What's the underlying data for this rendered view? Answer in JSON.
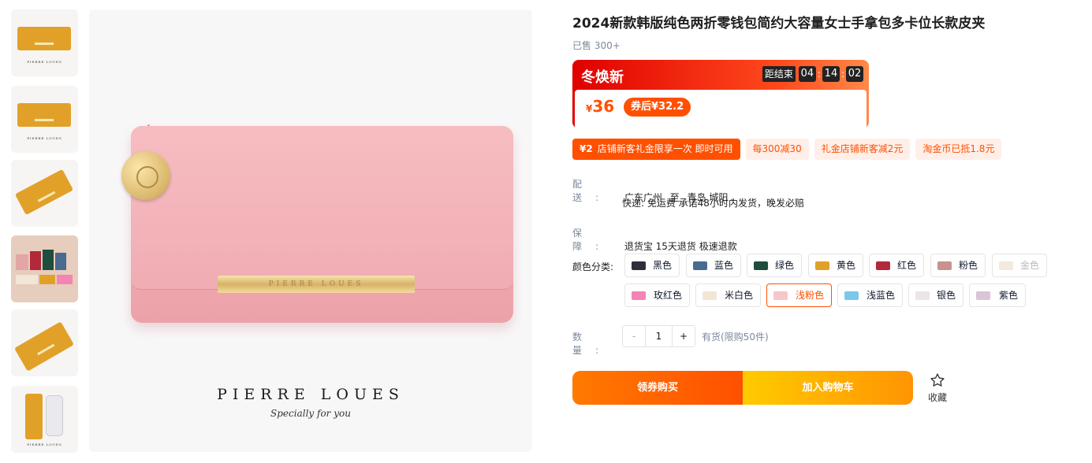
{
  "gallery": {
    "thumbnails": [
      {
        "brand_text": "PIERRE LOUES"
      },
      {
        "brand_text": "PIERRE LOUES"
      },
      {
        "brand_text": ""
      },
      {
        "brand_text": ""
      },
      {
        "brand_text": ""
      },
      {
        "brand_text": "PIERRE LOUES"
      }
    ],
    "main_brand": "PIERRE LOUES",
    "main_tagline": "Specially for you",
    "main_bar_text": "PIERRE LOUES",
    "selected_index": 3
  },
  "product": {
    "title": "2024新款韩版纯色两折零钱包简约大容量女士手拿包多卡位长款皮夹",
    "sold": "已售 300+"
  },
  "promo": {
    "label": "冬焕新",
    "countdown_label": "距结束",
    "hours": "04",
    "minutes": "14",
    "seconds": "02",
    "currency": "¥",
    "price": "36",
    "coupon_price": "券后¥32.2"
  },
  "tags": [
    {
      "amount": "¥2",
      "text": "店铺新客礼金限享一次 即时可用"
    },
    {
      "amount": "",
      "text": "每300减30"
    },
    {
      "amount": "",
      "text": "礼金店铺新客减2元"
    },
    {
      "amount": "",
      "text": "淘金币已抵1.8元"
    }
  ],
  "shipping": {
    "label": "配送:",
    "from": "广东广州",
    "to_word": "至",
    "to": "青岛 城阳",
    "detail": "快递: 免运费  承诺48小时内发货，晚发必赔"
  },
  "guarantee": {
    "label": "保障:",
    "text": "退货宝 15天退货 极速退款"
  },
  "colors": {
    "label": "颜色分类:",
    "options": [
      {
        "name": "黑色",
        "swatch": "#2d2f3a",
        "state": "normal"
      },
      {
        "name": "蓝色",
        "swatch": "#4a6a8f",
        "state": "normal"
      },
      {
        "name": "绿色",
        "swatch": "#1f4d3e",
        "state": "normal"
      },
      {
        "name": "黄色",
        "swatch": "#e1a128",
        "state": "normal"
      },
      {
        "name": "红色",
        "swatch": "#b3283a",
        "state": "normal"
      },
      {
        "name": "粉色",
        "swatch": "#c9928e",
        "state": "normal"
      },
      {
        "name": "金色",
        "swatch": "#f3e9df",
        "state": "disabled"
      },
      {
        "name": "玫红色",
        "swatch": "#f384b4",
        "state": "normal"
      },
      {
        "name": "米白色",
        "swatch": "#f2e6d6",
        "state": "normal"
      },
      {
        "name": "浅粉色",
        "swatch": "#f5c7c9",
        "state": "selected"
      },
      {
        "name": "浅蓝色",
        "swatch": "#7dc7ea",
        "state": "normal"
      },
      {
        "name": "银色",
        "swatch": "#ebe5ea",
        "state": "normal"
      },
      {
        "name": "紫色",
        "swatch": "#d9c5d7",
        "state": "normal"
      }
    ]
  },
  "quantity": {
    "label": "数量:",
    "minus": "-",
    "value": "1",
    "plus": "+",
    "stock": "有货(限购50件)"
  },
  "actions": {
    "buy": "领券购买",
    "cart": "加入购物车",
    "favorite": "收藏"
  }
}
